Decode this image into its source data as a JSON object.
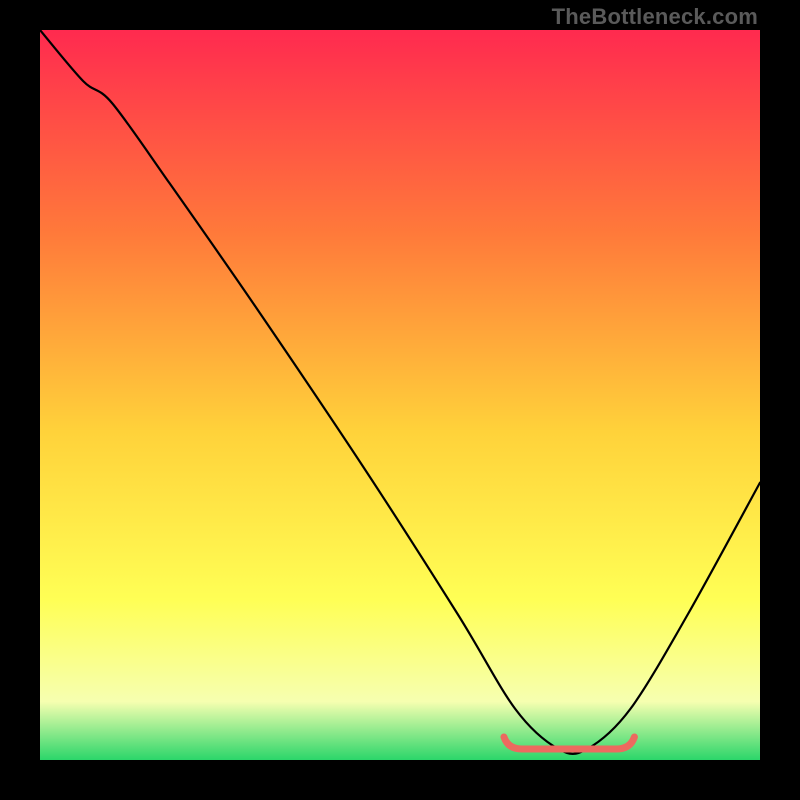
{
  "watermark": "TheBottleneck.com",
  "colors": {
    "bg": "#000000",
    "curve": "#000000",
    "marker": "#ec6a5f",
    "grad_top": "#ff2a4f",
    "grad_mid1": "#ff7a3a",
    "grad_mid2": "#ffd23a",
    "grad_mid3": "#ffff55",
    "grad_mid4": "#f6ffb0",
    "grad_bottom": "#2bd66a"
  },
  "chart_data": {
    "type": "line",
    "title": "",
    "xlabel": "",
    "ylabel": "",
    "xlim": [
      0,
      100
    ],
    "ylim": [
      0,
      100
    ],
    "series": [
      {
        "name": "bottleneck-curve",
        "x": [
          0,
          6,
          10,
          18,
          30,
          45,
          58,
          66,
          72,
          76,
          82,
          90,
          100
        ],
        "y": [
          100,
          93,
          90,
          79,
          62,
          40,
          20,
          7,
          1.5,
          1.5,
          7,
          20,
          38
        ]
      }
    ],
    "optimal_range": {
      "x_start": 65,
      "x_end": 82,
      "y": 1.5
    }
  }
}
